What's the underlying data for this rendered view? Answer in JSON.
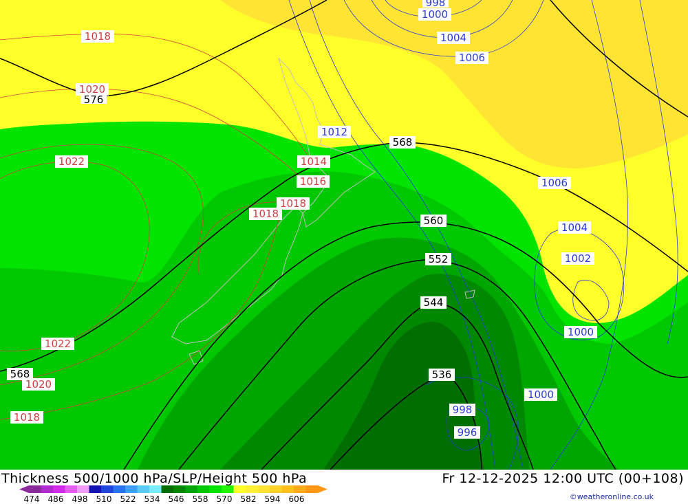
{
  "title": "Thickness 500/1000 hPa/SLP/Height 500 hPa",
  "valid_time": "Fr 12-12-2025 12:00 UTC (00+108)",
  "credit": "©weatheronline.co.uk",
  "colors": {
    "sea_bg": "#00e400",
    "zone_558_566": "#00e400",
    "zone_550_558": "#00c800",
    "zone_542_550": "#00a600",
    "zone_534_542": "#008800",
    "zone_526_534": "#006e00",
    "zone_566_574": "#ffff2a",
    "zone_574_582": "#ffe434",
    "slp_contour": "#d04040",
    "slp_low_contour": "#2a3ad8",
    "height_contour": "#000000",
    "coastline": "#c0c0c0"
  },
  "legend": {
    "ticks": [
      "474",
      "486",
      "498",
      "510",
      "522",
      "534",
      "546",
      "558",
      "570",
      "582",
      "594",
      "606"
    ],
    "colors": [
      "#8a2a9c",
      "#b02ad0",
      "#d22ae8",
      "#e65cf4",
      "#f29af8",
      "#1414b4",
      "#1e46dc",
      "#2874f0",
      "#3ca0f8",
      "#5acaf8",
      "#78ecf8",
      "#006e00",
      "#008800",
      "#00a600",
      "#00c800",
      "#00e400",
      "#20f400",
      "#ffff2a",
      "#fff034",
      "#ffe434",
      "#ffd22a",
      "#ffc01e",
      "#ffa818",
      "#ff9614"
    ]
  },
  "slp_labels": [
    {
      "text": "1018"
    },
    {
      "text": "1020"
    },
    {
      "text": "1022"
    },
    {
      "text": "1014"
    },
    {
      "text": "1016"
    },
    {
      "text": "1018"
    },
    {
      "text": "1018"
    },
    {
      "text": "1022"
    },
    {
      "text": "1020"
    },
    {
      "text": "1018"
    }
  ],
  "low_labels": [
    {
      "text": "998"
    },
    {
      "text": "1000"
    },
    {
      "text": "1004"
    },
    {
      "text": "1006"
    },
    {
      "text": "1012"
    },
    {
      "text": "1006"
    },
    {
      "text": "1004"
    },
    {
      "text": "1002"
    },
    {
      "text": "1000"
    },
    {
      "text": "1000"
    },
    {
      "text": "998"
    },
    {
      "text": "996"
    }
  ],
  "height_labels": [
    {
      "text": "576"
    },
    {
      "text": "568"
    },
    {
      "text": "560"
    },
    {
      "text": "552"
    },
    {
      "text": "544"
    },
    {
      "text": "536"
    },
    {
      "text": "568"
    }
  ]
}
